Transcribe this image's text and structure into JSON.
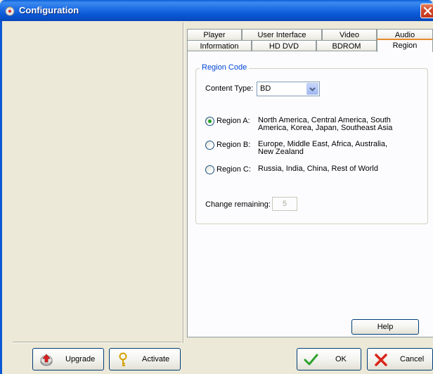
{
  "window": {
    "title": "Configuration",
    "close_icon": "close-icon"
  },
  "left_buttons": [
    {
      "label": "Upgrade",
      "icon": "upgrade-icon"
    },
    {
      "label": "Activate",
      "icon": "key-icon"
    }
  ],
  "tabs_row1": [
    "Player",
    "User Interface",
    "Video",
    "Audio"
  ],
  "tabs_row2": [
    "Information",
    "HD DVD",
    "BDROM",
    "Region"
  ],
  "active_tab": "Region",
  "region": {
    "group_title": "Region Code",
    "content_type_label": "Content Type:",
    "content_type_value": "BD",
    "options": [
      {
        "label": "Region A:",
        "desc_line1": "North America, Central America, South",
        "desc_line2": "America, Korea, Japan, Southeast Asia",
        "selected": true
      },
      {
        "label": "Region B:",
        "desc_line1": "Europe, Middle East, Africa, Australia,",
        "desc_line2": "New Zealand",
        "selected": false
      },
      {
        "label": "Region C:",
        "desc_line1": "Russia, India, China, Rest of World",
        "desc_line2": "",
        "selected": false
      }
    ],
    "change_remaining_label": "Change remaining:",
    "change_remaining_value": "5"
  },
  "help_label": "Help",
  "ok_label": "OK",
  "cancel_label": "Cancel",
  "colors": {
    "titlebar": "#0a57d4",
    "window_bg": "#ece9d8",
    "tab_accent": "#e68b2c",
    "group_title": "#0046d5"
  }
}
